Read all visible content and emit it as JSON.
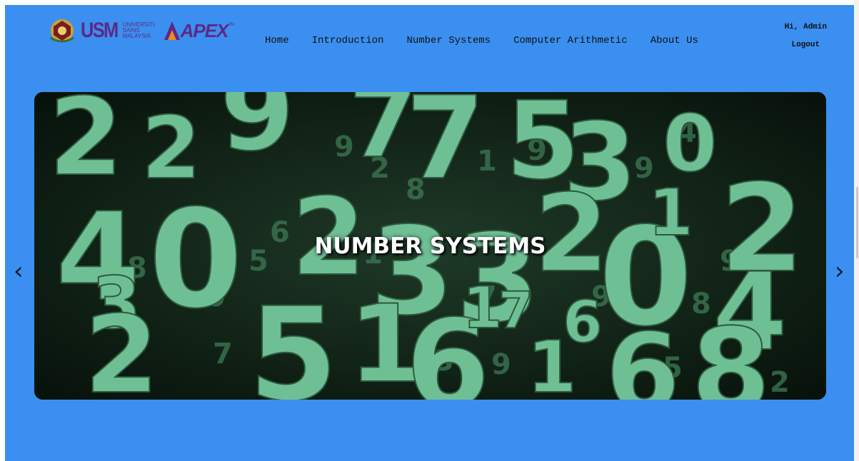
{
  "header": {
    "usm_logo": "USM",
    "usm_subtext": [
      "UNIVERSITI",
      "SAINS",
      "MALAYSIA"
    ],
    "apex_logo": "APEX",
    "apex_tm": "TM"
  },
  "nav": {
    "items": [
      "Home",
      "Introduction",
      "Number Systems",
      "Computer Arithmetic",
      "About Us"
    ]
  },
  "user": {
    "greeting": "Hi, Admin",
    "logout": "Logout"
  },
  "carousel": {
    "caption": "NUMBER SYSTEMS",
    "prev": "‹",
    "next": "›"
  },
  "colors": {
    "background": "#3b8ff0",
    "brand_purple": "#5b2a86",
    "digit_green": "#6fbf95"
  },
  "icons": [
    "crest-icon",
    "chevron-left-icon",
    "chevron-right-icon"
  ]
}
